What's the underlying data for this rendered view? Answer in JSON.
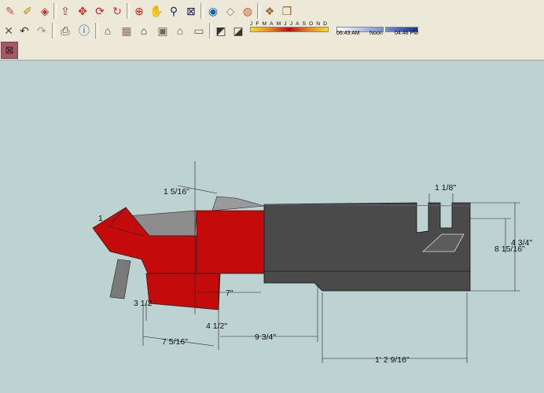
{
  "toolbar": {
    "row1_icons": [
      "eraser-icon",
      "tape-measure-icon",
      "paint-bucket-icon",
      "push-pull-icon",
      "move-icon",
      "rotate-icon",
      "follow-me-icon",
      "orbit-icon",
      "pan-icon",
      "zoom-icon",
      "zoom-extents-icon",
      "get-models-icon",
      "share-model-icon",
      "google-earth-icon",
      "component-icon",
      "materials-icon"
    ],
    "row2_icons": [
      "close-icon",
      "undo-icon",
      "redo-icon",
      "print-icon",
      "model-info-icon",
      "iso-view-icon",
      "top-view-icon",
      "front-view-icon",
      "right-view-icon",
      "back-view-icon",
      "left-view-icon",
      "shadow-settings-icon",
      "shadows-toggle-icon"
    ],
    "row3_icons": [
      "section-plane-icon"
    ]
  },
  "shadow": {
    "months": [
      "J",
      "F",
      "M",
      "A",
      "M",
      "J",
      "J",
      "A",
      "S",
      "O",
      "N",
      "D"
    ],
    "sunrise_time": "06:43 AM",
    "noon_label": "Noon",
    "sunset_time": "04:46 PM"
  },
  "dimensions": {
    "top_left": "1 5/16\"",
    "top_right": "1 1/8\"",
    "right_upper": "4 3/4\"",
    "right_total": "8 15/16\"",
    "bottom_7": "7\"",
    "left_31": "3 1/2",
    "bottom_4_half": "4 1/2\"",
    "bottom_7_5_16": "7 5/16\"",
    "bottom_9_3_4": "9 3/4\"",
    "bottom_long": "1' 2 9/16\"",
    "left_stub": "1"
  },
  "colors": {
    "background": "#bcd3d1",
    "red_face": "#c40a0a",
    "dark_face": "#4a4a4a",
    "gray_face": "#8d8d8d"
  }
}
